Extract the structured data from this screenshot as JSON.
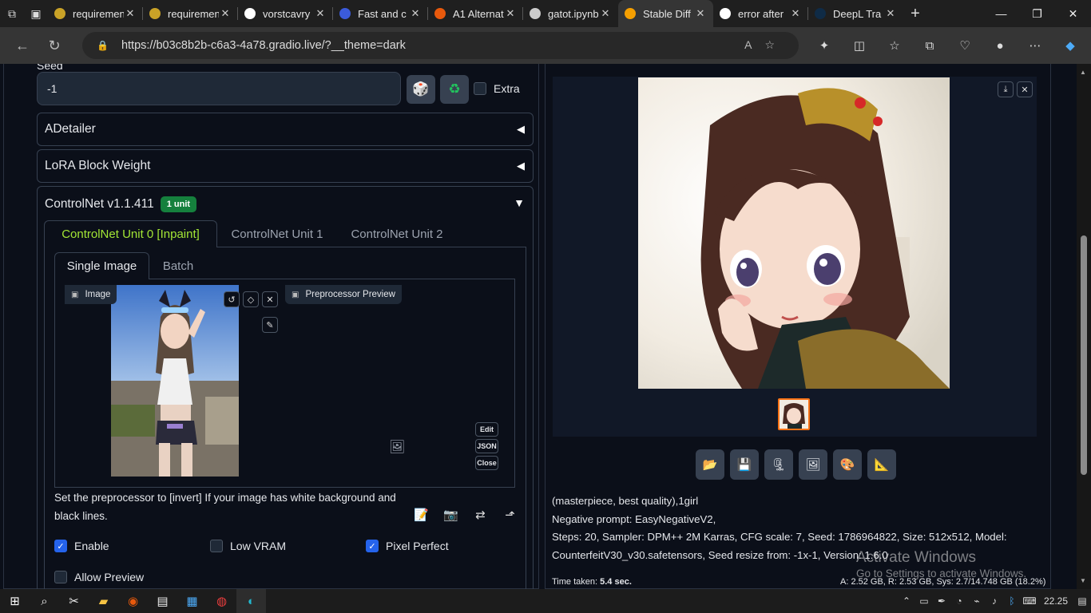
{
  "browser": {
    "tabs": [
      {
        "title": "requirements",
        "fav": "#c9a227"
      },
      {
        "title": "requirements",
        "fav": "#c9a227"
      },
      {
        "title": "vorstcavry",
        "fav": "#ffffff"
      },
      {
        "title": "Fast and c",
        "fav": "#3b5bdb"
      },
      {
        "title": "A1 Alternat",
        "fav": "#e8590c"
      },
      {
        "title": "gatot.ipynb",
        "fav": "#cccccc"
      },
      {
        "title": "Stable Diff",
        "fav": "#f59f00"
      },
      {
        "title": "error after",
        "fav": "#ffffff"
      },
      {
        "title": "DeepL Tra",
        "fav": "#0f2b46"
      }
    ],
    "url": "https://b03c8b2b-c6a3-4a78.gradio.live/?__theme=dark"
  },
  "left": {
    "seed_label": "Seed",
    "seed_value": "-1",
    "extra_label": "Extra",
    "accordions": [
      "ADetailer",
      "LoRA Block Weight"
    ],
    "controlnet": {
      "title": "ControlNet v1.1.411",
      "badge": "1 unit",
      "unit_tabs": [
        "ControlNet Unit 0 [Inpaint]",
        "ControlNet Unit 1",
        "ControlNet Unit 2"
      ],
      "sub_tabs": [
        "Single Image",
        "Batch"
      ],
      "image_label": "Image",
      "preproc_label": "Preprocessor Preview",
      "small_buttons": [
        "Edit",
        "JSON",
        "Close"
      ],
      "hint": "Set the preprocessor to [invert] If your image has white background and black lines.",
      "checks": {
        "enable": "Enable",
        "low_vram": "Low VRAM",
        "pixel_perfect": "Pixel Perfect",
        "allow_preview": "Allow Preview"
      }
    }
  },
  "right": {
    "info_line1": "(masterpiece, best quality),1girl",
    "info_line2": "Negative prompt: EasyNegativeV2,",
    "info_line3": "Steps: 20, Sampler: DPM++ 2M Karras, CFG scale: 7, Seed: 1786964822, Size: 512x512, Model:",
    "info_line4": "CounterfeitV30_v30.safetensors, Seed resize from: -1x-1, Version: 1.6.0",
    "time_label": "Time taken:",
    "time_value": "5.4 sec.",
    "vram": "A: 2.52 GB, R: 2.53 GB, Sys: 2.7/14.748 GB (18.2%)"
  },
  "os": {
    "activate_title": "Activate Windows",
    "activate_sub": "Go to Settings to activate Windows.",
    "clock": "22.25"
  }
}
